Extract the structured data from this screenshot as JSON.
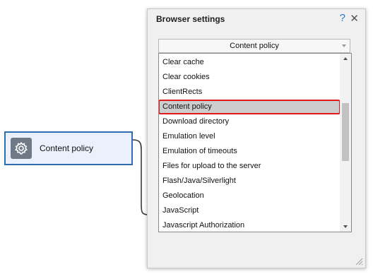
{
  "node": {
    "label": "Content policy",
    "icon": "gear-icon",
    "border_color": "#2f6db3",
    "background": "#eaf1fa"
  },
  "window": {
    "title": "Browser settings",
    "help_glyph": "?",
    "close_glyph": "✕",
    "combo": {
      "value": "Content policy"
    },
    "dropdown": {
      "selected_index": 3,
      "highlight_color": "#e21a1a",
      "items": [
        "Clear cache",
        "Clear cookies",
        "ClientRects",
        "Content policy",
        "Download directory",
        "Emulation level",
        "Emulation of timeouts",
        "Files for upload to the server",
        "Flash/Java/Silverlight",
        "Geolocation",
        "JavaScript",
        "Javascript Authorization"
      ]
    }
  }
}
